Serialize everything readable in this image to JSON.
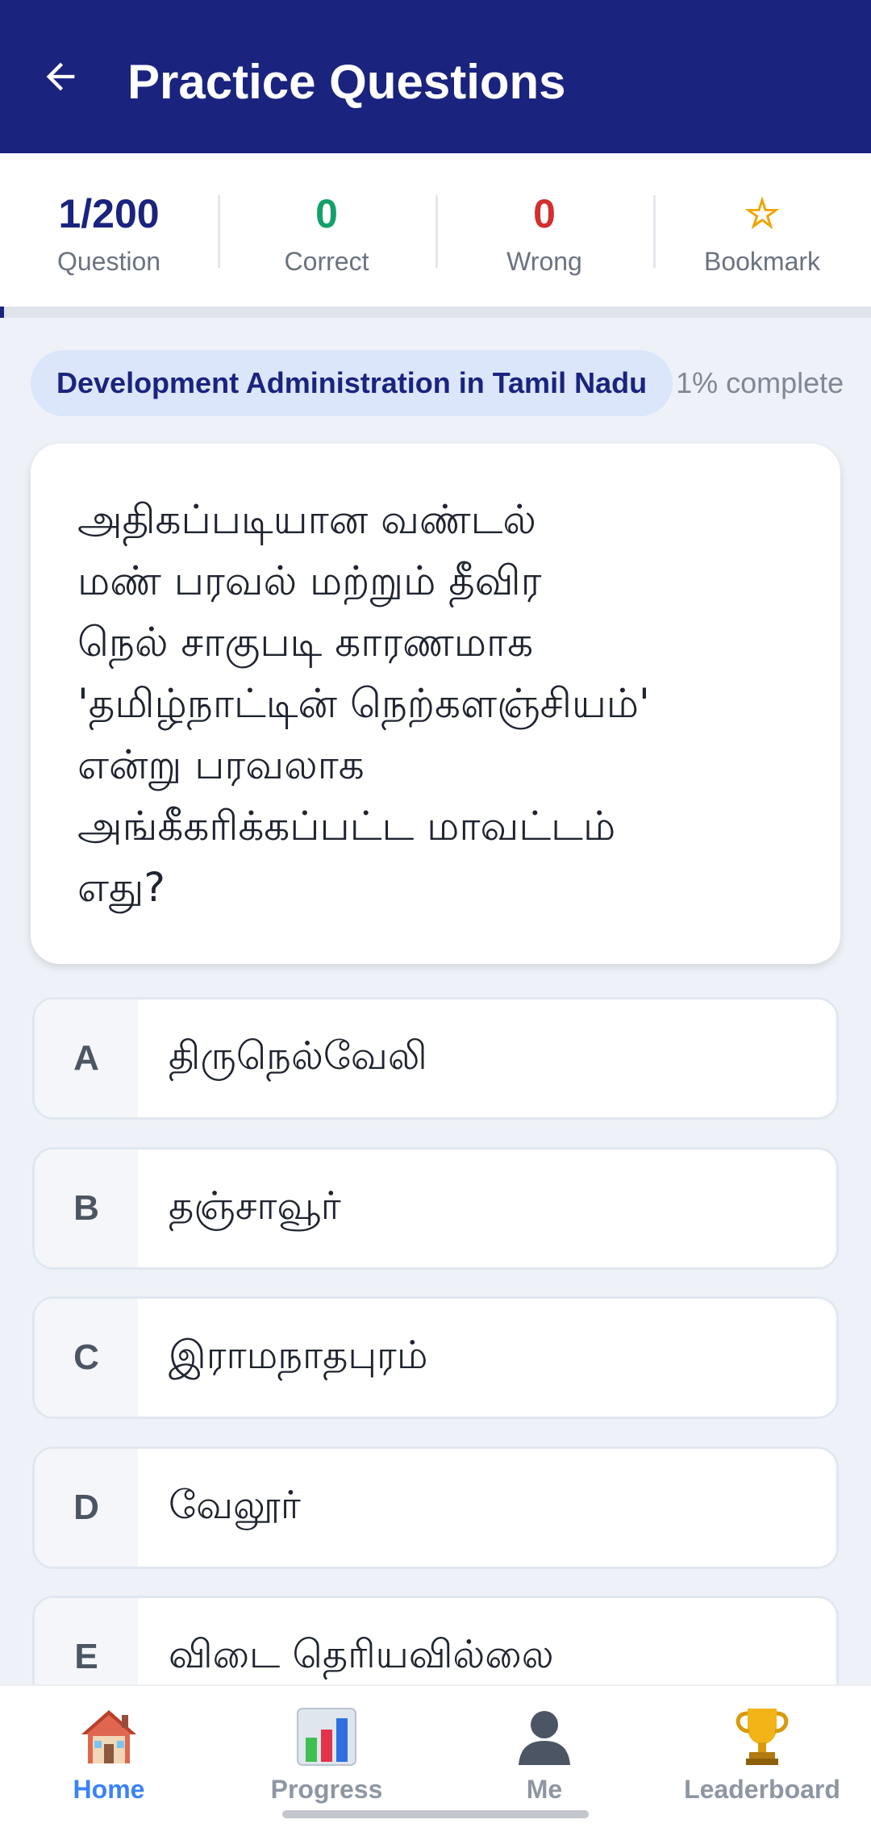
{
  "header": {
    "title": "Practice Questions",
    "back_icon": "arrow-left-icon",
    "background": "#1a237e"
  },
  "stats": [
    {
      "value": "1/200",
      "label": "Question",
      "color": "#1a237e"
    },
    {
      "value": "0",
      "label": "Correct",
      "color": "#14a06b"
    },
    {
      "value": "0",
      "label": "Wrong",
      "color": "#d32f2f"
    },
    {
      "value": "☆",
      "label": "Bookmark",
      "color": "#f0a500"
    }
  ],
  "progress": {
    "fraction": 0.005
  },
  "topic": {
    "name": "Development Administration in Tamil Nadu",
    "complete_text": "1% complete"
  },
  "question": {
    "lines": [
      "அதிகப்படியான வண்டல்",
      "மண் பரவல் மற்றும் தீவிர",
      "நெல் சாகுபடி காரணமாக",
      "'தமிழ்நாட்டின் நெற்களஞ்சியம்'",
      "என்று பரவலாக",
      "அங்கீகரிக்கப்பட்ட மாவட்டம்",
      "எது?"
    ]
  },
  "options": [
    {
      "letter": "A",
      "text": "திருநெல்வேலி"
    },
    {
      "letter": "B",
      "text": "தஞ்சாவூர்"
    },
    {
      "letter": "C",
      "text": "இராமநாதபுரம்"
    },
    {
      "letter": "D",
      "text": "வேலூர்"
    },
    {
      "letter": "E",
      "text": "விடை தெரியவில்லை"
    }
  ],
  "nav": [
    {
      "label": "Home",
      "icon": "house-icon",
      "active": true
    },
    {
      "label": "Progress",
      "icon": "bar-chart-icon",
      "active": false
    },
    {
      "label": "Me",
      "icon": "person-silhouette-icon",
      "active": false
    },
    {
      "label": "Leaderboard",
      "icon": "trophy-icon",
      "active": false
    }
  ]
}
